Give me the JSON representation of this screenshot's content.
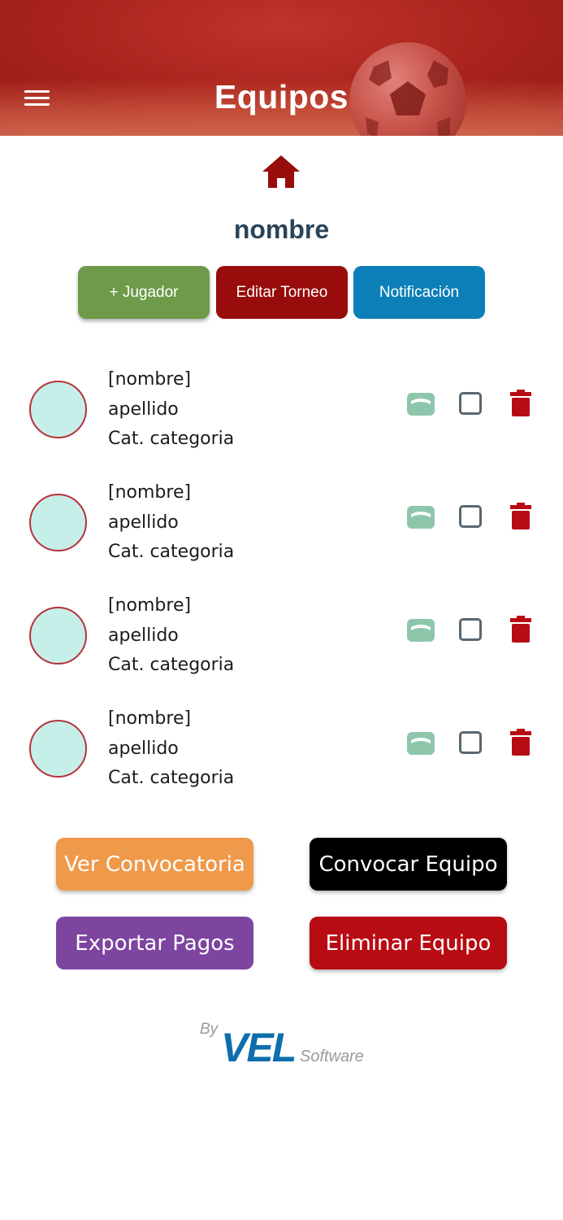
{
  "header": {
    "title": "Equipos"
  },
  "team": {
    "name": "nombre"
  },
  "actions": {
    "add_player": "+ Jugador",
    "edit_tournament": "Editar Torneo",
    "notification": "Notificación"
  },
  "players": [
    {
      "name": "[nombre]",
      "last_name": "apellido",
      "category": "Cat. categoria",
      "checked": false
    },
    {
      "name": "[nombre]",
      "last_name": "apellido",
      "category": "Cat. categoria",
      "checked": false
    },
    {
      "name": "[nombre]",
      "last_name": "apellido",
      "category": "Cat. categoria",
      "checked": false
    },
    {
      "name": "[nombre]",
      "last_name": "apellido",
      "category": "Cat. categoria",
      "checked": false
    }
  ],
  "bottom_actions": {
    "view_call": "Ver Convocatoria",
    "call_team": "Convocar Equipo",
    "export_payments": "Exportar Pagos",
    "delete_team": "Eliminar Equipo"
  },
  "footer": {
    "by": "By",
    "brand": "VEL",
    "software": "Software"
  },
  "colors": {
    "header": "#a8231c",
    "primary_text": "#2a4459",
    "add_button": "#6e9a4a",
    "edit_button": "#980c0c",
    "notification_button": "#0d7fb8",
    "view_call_button": "#ee9a4a",
    "call_team_button": "#000000",
    "export_button": "#7d44a0",
    "delete_button": "#b80c14",
    "avatar_fill": "#c6efea",
    "card_icon": "#8ec6ac",
    "trash_icon": "#b80c14",
    "brand_blue": "#0d6fae"
  }
}
